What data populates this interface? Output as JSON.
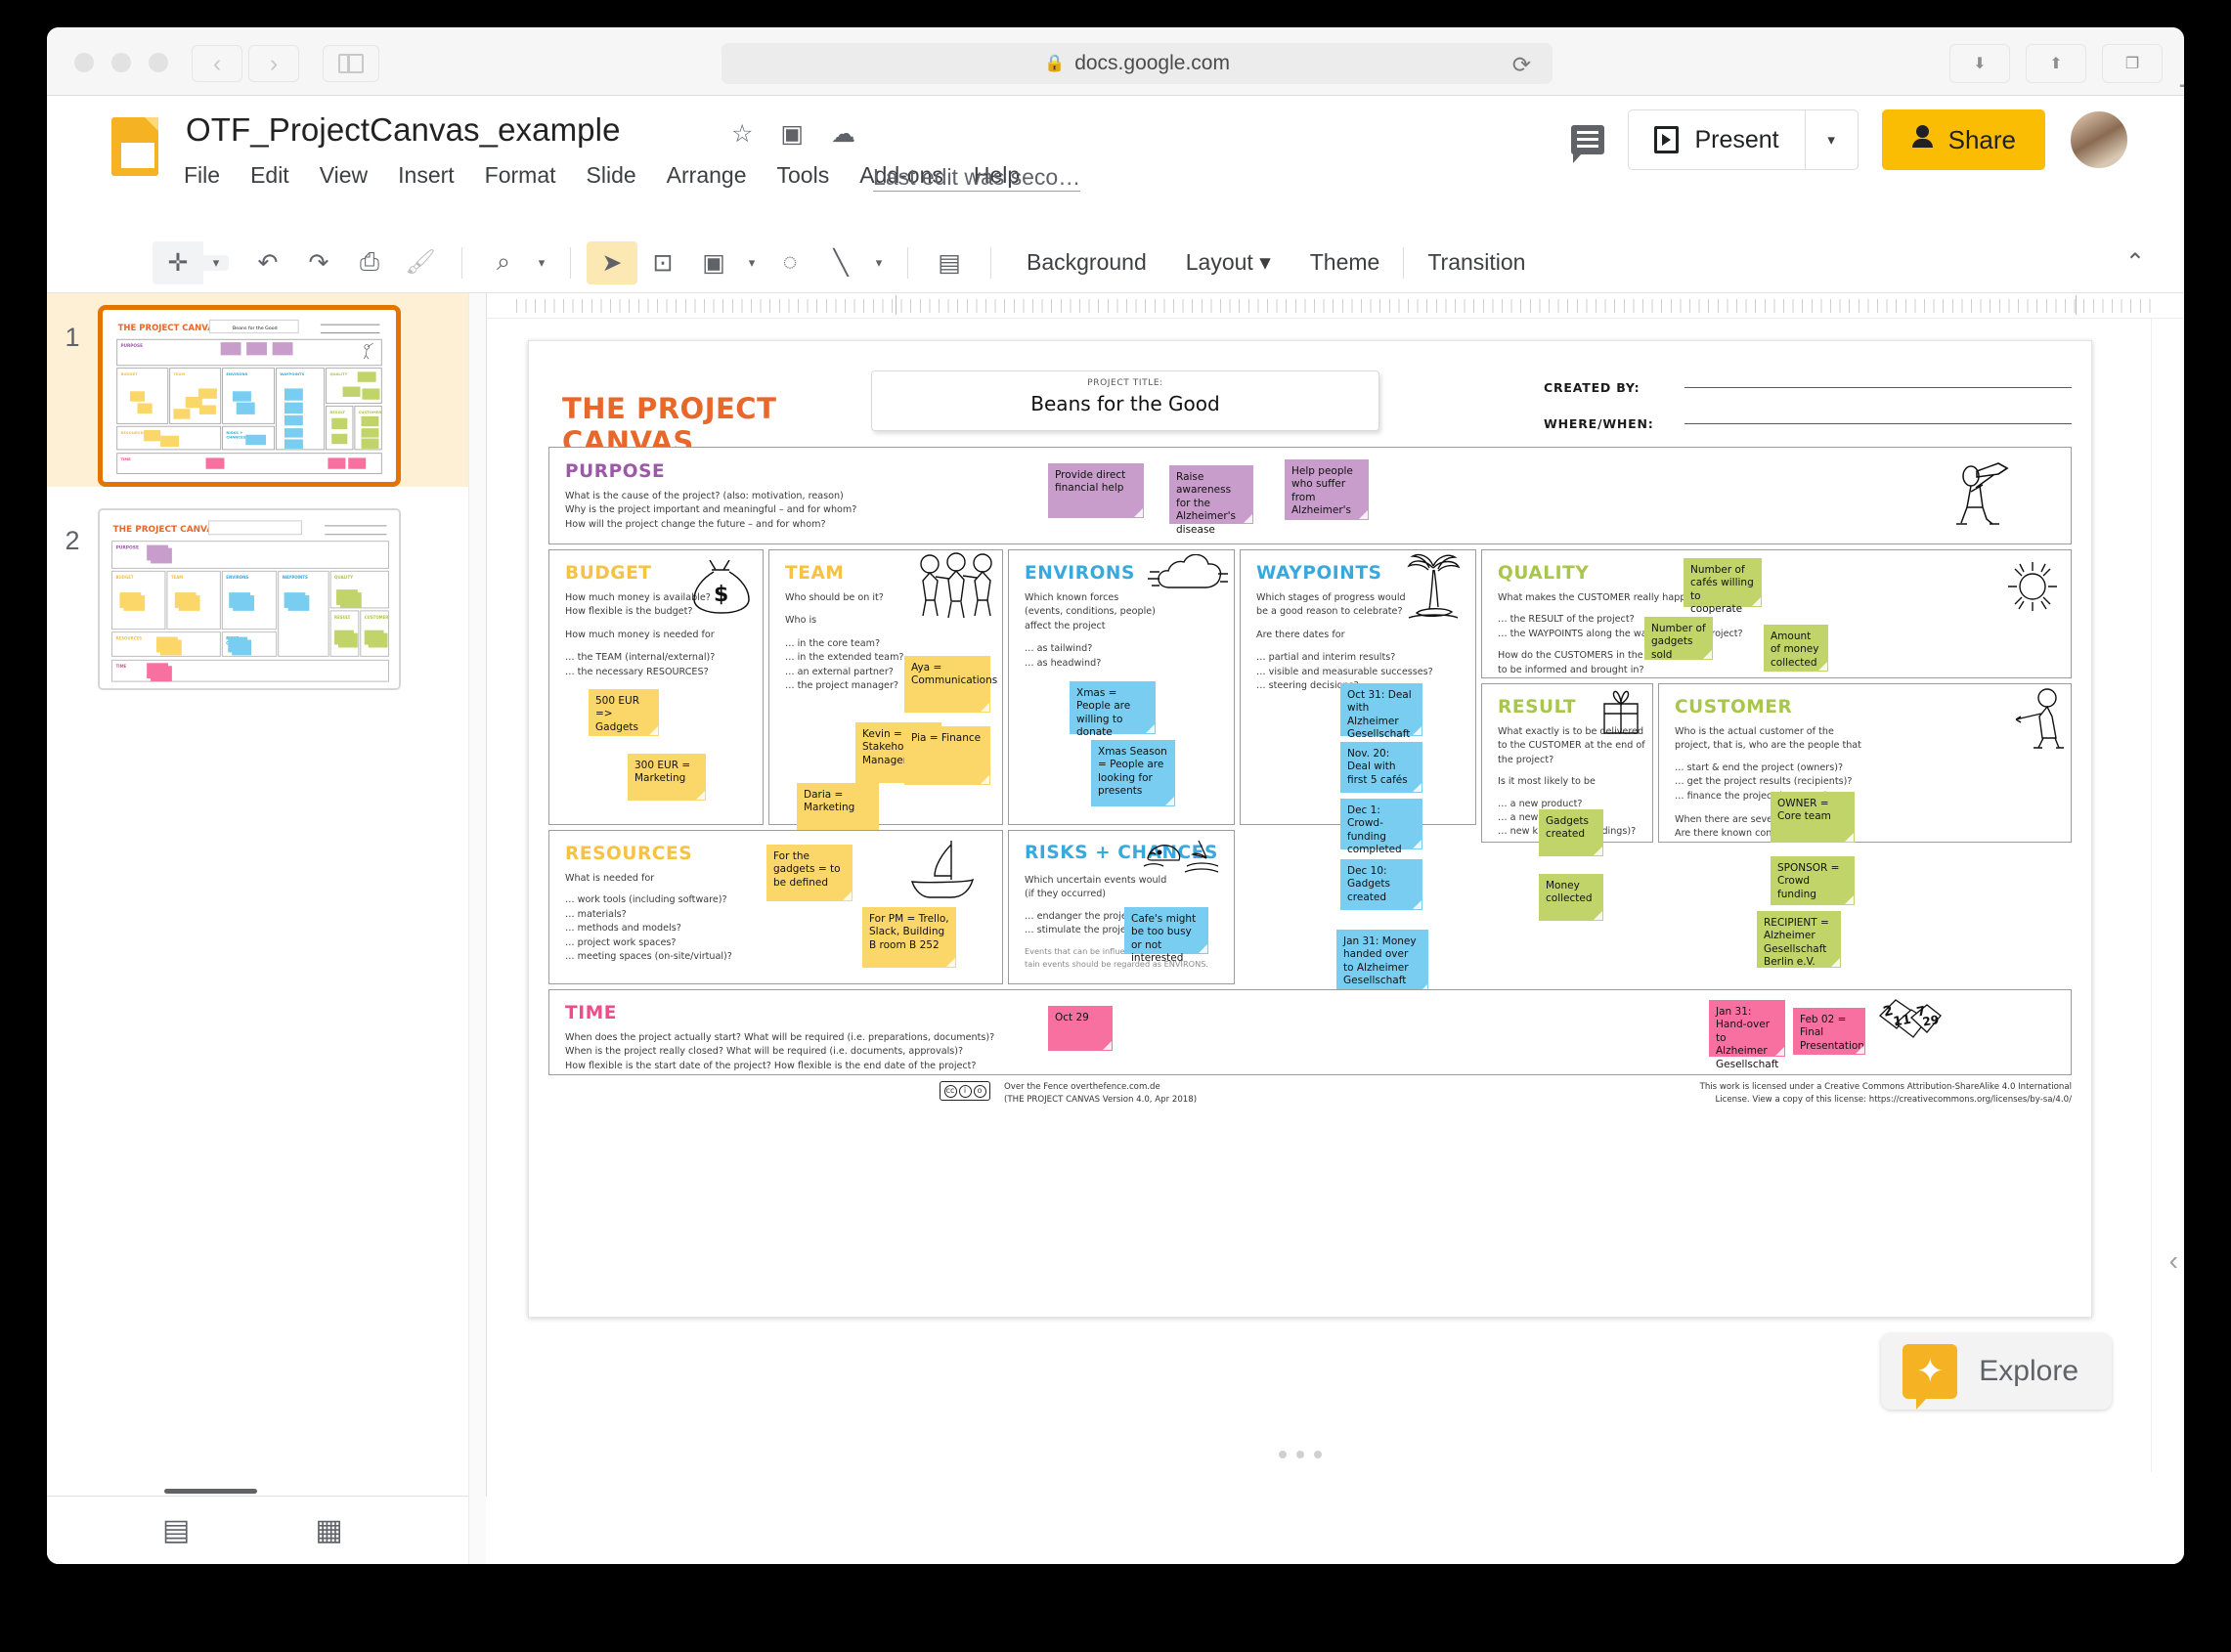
{
  "browser": {
    "url": "docs.google.com",
    "lock_icon": "lock-icon",
    "reload_icon": "reload-icon",
    "back_icon": "back-icon",
    "forward_icon": "forward-icon",
    "sidebar_icon": "sidebar-toggle-icon",
    "download_icon": "download-icon",
    "share_icon": "share-icon",
    "tabs_icon": "tab-overview-icon",
    "new_tab_icon": "new-tab-icon"
  },
  "docs": {
    "title": "OTF_ProjectCanvas_example",
    "star_icon": "star-icon",
    "move_icon": "move-to-folder-icon",
    "cloud_icon": "cloud-status-icon",
    "menus": [
      "File",
      "Edit",
      "View",
      "Insert",
      "Format",
      "Slide",
      "Arrange",
      "Tools",
      "Add-ons",
      "Help"
    ],
    "last_edit": "Last edit was seco…",
    "comment_icon": "comment-icon",
    "present_label": "Present",
    "present_caret": "▾",
    "share_label": "Share",
    "avatar": "user-avatar"
  },
  "toolbar": {
    "new_label": "+",
    "items": [
      "new-slide-icon",
      "undo-icon",
      "redo-icon",
      "print-icon",
      "paint-format-icon",
      "zoom-icon",
      "select-icon",
      "textbox-icon",
      "image-icon",
      "shape-icon",
      "line-icon",
      "comment-add-icon"
    ],
    "background": "Background",
    "layout": "Layout",
    "theme": "Theme",
    "transition": "Transition",
    "collapse_icon": "collapse-toolbar-icon"
  },
  "filmstrip": {
    "slides": [
      {
        "number": "1",
        "selected": true
      },
      {
        "number": "2",
        "selected": false
      }
    ],
    "grid_view_icon": "grid-view-icon",
    "filmstrip_view_icon": "filmstrip-view-icon"
  },
  "explore": {
    "label": "Explore",
    "icon": "explore-star-icon"
  },
  "canvas": {
    "brand_title": "THE PROJECT CANVAS",
    "project_title_label": "PROJECT TITLE:",
    "project_title_value": "Beans for the Good",
    "created_by_label": "CREATED BY:",
    "where_when_label": "WHERE/WHEN:",
    "sections": {
      "purpose": {
        "title": "PURPOSE",
        "color": "#9b59a8",
        "questions": [
          "What is the cause of the project? (also: motivation, reason)",
          "Why is the project important and meaningful – and for whom?",
          "How will the project change the future – and for whom?"
        ],
        "icon": "telescope-person-doodle",
        "notes": [
          "Provide direct financial help",
          "Raise awareness for the Alzheimer's disease",
          "Help people who suffer from Alzheimer's"
        ]
      },
      "budget": {
        "title": "BUDGET",
        "color": "#f5c243",
        "icon": "money-bag-doodle",
        "questions": [
          "How much money is available?",
          "How flexible is the budget?",
          "",
          "How much money is needed for",
          "",
          "… the TEAM (internal/external)?",
          "… the necessary RESOURCES?"
        ],
        "notes": [
          "500 EUR => Gadgets",
          "300 EUR = Marketing"
        ]
      },
      "team": {
        "title": "TEAM",
        "color": "#f5c243",
        "icon": "three-people-doodle",
        "questions": [
          "Who should be on it?",
          "",
          "Who is",
          "",
          "… in the core team?",
          "… in the extended team?",
          "… an external partner?",
          "… the project manager?"
        ],
        "notes": [
          "Aya = Communications",
          "Kevin = Stakeholder Management",
          "Pia = Finance",
          "Daria = Marketing"
        ]
      },
      "environs": {
        "title": "ENVIRONS",
        "color": "#39a8dd",
        "icon": "cloud-wind-doodle",
        "questions": [
          "Which known forces",
          "(events, conditions, people)",
          "affect the project",
          "",
          "… as tailwind?",
          "… as headwind?"
        ],
        "notes": [
          "Xmas = People are willing to donate",
          "Xmas Season = People are looking for presents"
        ]
      },
      "waypoints": {
        "title": "WAYPOINTS",
        "color": "#39a8dd",
        "icon": "palm-tree-doodle",
        "questions": [
          "Which stages of progress would",
          "be a good reason to celebrate?",
          "",
          "Are there dates for",
          "",
          "… partial and interim results?",
          "… visible and measurable successes?",
          "… steering decisions?"
        ],
        "notes": [
          "Oct 31: Deal with Alzheimer Gesellschaft",
          "Nov. 20: Deal with first 5 cafés",
          "Dec 1: Crowd-funding completed",
          "Dec 10: Gadgets created",
          "Jan 31: Money handed over to Alzheimer Gesellschaft"
        ]
      },
      "quality": {
        "title": "QUALITY",
        "color": "#a9c64c",
        "icon": "sun-doodle",
        "questions": [
          "What makes the CUSTOMER really happy with regard to",
          "",
          "… the RESULT of the project?",
          "… the WAYPOINTS along the way within the project?",
          "",
          "How do the CUSTOMERS in the project want",
          "to be informed and brought in?"
        ],
        "notes": [
          "Number of cafés willing to cooperate",
          "Number of gadgets sold",
          "Amount of money collected"
        ]
      },
      "result": {
        "title": "RESULT",
        "color": "#a9c64c",
        "icon": "gift-doodle",
        "questions": [
          "What exactly is to be delivered",
          "to the CUSTOMER at the end of the project?",
          "",
          "Is it most likely to be",
          "",
          "… a new product?",
          "… a new service?",
          "… new knowledge (findings)?"
        ],
        "notes": [
          "Gadgets created",
          "Money collected"
        ]
      },
      "customer": {
        "title": "CUSTOMER",
        "color": "#a9c64c",
        "icon": "pointing-person-doodle",
        "questions": [
          "Who is the actual customer of the",
          "project, that is, who are the people that",
          "",
          "… start & end the project (owners)?",
          "… get the project results (recipients)?",
          "… finance the project (sponsors)?",
          "",
          "When there are several p",
          "Are there known conflict"
        ],
        "notes": [
          "OWNER = Core team",
          "SPONSOR = Crowd funding",
          "RECIPIENT = Alzheimer Gesellschaft Berlin e.V."
        ]
      },
      "resources": {
        "title": "RESOURCES",
        "color": "#f5c243",
        "icon": "sailboat-doodle",
        "questions": [
          "What is needed for",
          "",
          "… work tools (including software)?",
          "… materials?",
          "… methods and models?",
          "… project work spaces?",
          "… meeting spaces (on-site/virtual)?"
        ],
        "notes": [
          "For the gadgets = to be defined",
          "For PM = Trello, Slack, Building B room B 252"
        ]
      },
      "risks": {
        "title": "RISKS + CHANCES",
        "color": "#39a8dd",
        "icon": "whale-shark-doodle",
        "questions": [
          "Which uncertain events would",
          "(if they occurred)",
          "",
          "… endanger the project",
          "… stimulate the project"
        ],
        "footnote": [
          "Events that can be influence",
          "tain events should be regarded as ENVIRONS."
        ],
        "notes": [
          "Cafe's might be too busy or not interested"
        ]
      },
      "time": {
        "title": "TIME",
        "color": "#ef4d8a",
        "icon": "calendar-pages-doodle",
        "questions": [
          "When does the project actually start? What will be required (i.e. preparations, documents)?",
          "When is the project really closed? What will be required (i.e. documents, approvals)?",
          "How flexible is the start date of the project? How flexible is the end date of the project?"
        ],
        "notes": [
          "Oct 29",
          "Jan 31: Hand-over to Alzheimer Gesellschaft",
          "Feb 02 = Final Presentation"
        ]
      }
    },
    "footer": {
      "cc_icon": "creative-commons-icon",
      "attribution_line1": "Over the Fence overthefence.com.de",
      "attribution_line2": "(THE PROJECT CANVAS Version 4.0, Apr 2018)",
      "license_line1": "This work is licensed under a Creative Commons Attribution-ShareAlike 4.0 International",
      "license_line2": "License. View a copy of this license: https://creativecommons.org/licenses/by-sa/4.0/"
    }
  }
}
